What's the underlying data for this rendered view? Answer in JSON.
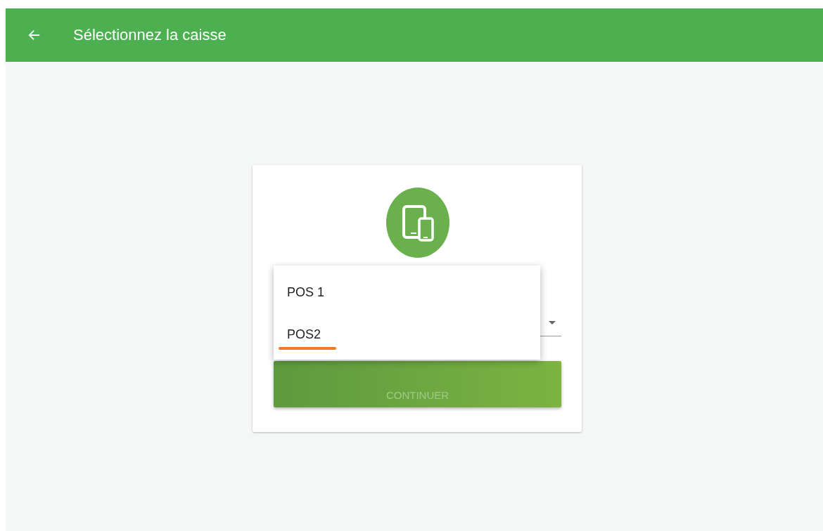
{
  "app_bar": {
    "title": "Sélectionnez la caisse"
  },
  "dropdown": {
    "options": [
      {
        "label": "POS 1",
        "selected": false
      },
      {
        "label": "POS2",
        "selected": true
      }
    ]
  },
  "button": {
    "label": "CONTINUER",
    "disabled": true
  }
}
